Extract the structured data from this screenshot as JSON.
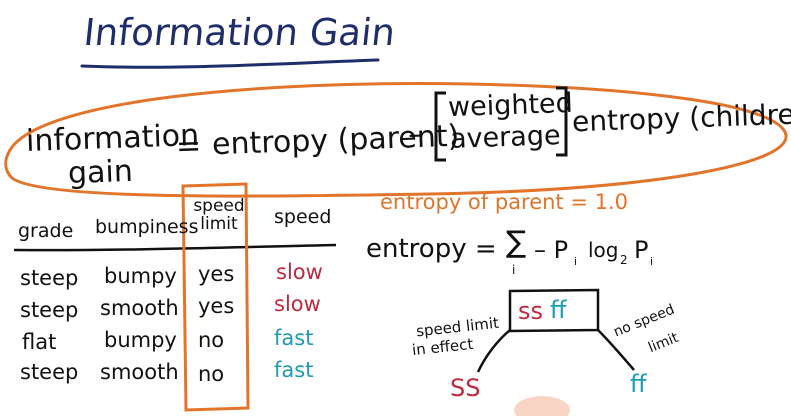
{
  "title": "Information Gain",
  "formula": {
    "lhs_line1": "information",
    "lhs_line2": "gain",
    "equals": "=",
    "term1": "entropy (parent)",
    "minus": "–",
    "weighted": "weighted",
    "average": "average",
    "term2": "entropy (children)"
  },
  "table": {
    "headers": [
      "grade",
      "bumpiness",
      "speed limit",
      "speed"
    ],
    "rows": [
      [
        "steep",
        "bumpy",
        "yes",
        "slow"
      ],
      [
        "steep",
        "smooth",
        "yes",
        "slow"
      ],
      [
        "flat",
        "bumpy",
        "no",
        "fast"
      ],
      [
        "steep",
        "smooth",
        "no",
        "fast"
      ]
    ]
  },
  "entropy_parent": "entropy of parent = 1.0",
  "entropy_formula": {
    "left": "entropy =",
    "sigma": "∑",
    "sub_i": "i",
    "term": "– P",
    "sub_i2": "i",
    "log": "log",
    "sub_2": "2",
    "p": "P",
    "sub_i3": "i"
  },
  "tree": {
    "root_ss": "ss",
    "root_ff": "ff",
    "left_label_line1": "speed limit",
    "left_label_line2": "in effect",
    "right_label_line1": "no speed",
    "right_label_line2": "limit",
    "left_leaf": "SS",
    "right_leaf": "ff"
  },
  "colors": {
    "title_blue": "#1f2e6b",
    "ellipse_orange": "#e2752b",
    "slow_red": "#c0283f",
    "fast_teal": "#1f9bb4"
  }
}
